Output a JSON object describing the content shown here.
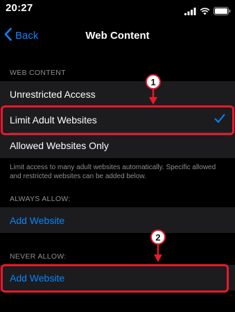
{
  "status_bar": {
    "time": "20:27"
  },
  "nav": {
    "back_label": "Back",
    "title": "Web Content"
  },
  "sections": {
    "web_content_header": "WEB CONTENT",
    "options": [
      {
        "label": "Unrestricted Access",
        "selected": false
      },
      {
        "label": "Limit Adult Websites",
        "selected": true
      },
      {
        "label": "Allowed Websites Only",
        "selected": false
      }
    ],
    "footer": "Limit access to many adult websites automatically. Specific allowed and restricted websites can be added below.",
    "always_allow_header": "ALWAYS ALLOW:",
    "always_allow_add": "Add Website",
    "never_allow_header": "NEVER ALLOW:",
    "never_allow_add": "Add Website"
  },
  "annotations": {
    "badge_1": "1",
    "badge_2": "2",
    "color": "#e8192c"
  },
  "colors": {
    "accent": "#0a84ff",
    "background": "#000000",
    "cell": "#1c1c1e",
    "secondary_text": "#8e8e93"
  }
}
